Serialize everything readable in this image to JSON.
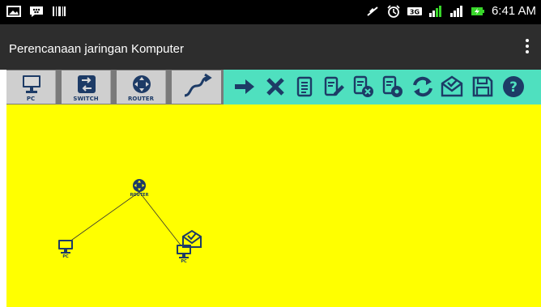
{
  "status_bar": {
    "left_icons": [
      "image-notification-icon",
      "bbm-notification-icon",
      "barcode-notification-icon"
    ],
    "right_icons": [
      "mute-icon",
      "alarm-icon",
      "3g-icon",
      "signal-icon",
      "signal-icon-2",
      "battery-charging-icon"
    ],
    "time": "6:41 AM"
  },
  "action_bar": {
    "title": "Perencanaan jaringan Komputer",
    "overflow_icon": "overflow-menu-icon"
  },
  "toolbar": {
    "devices": [
      {
        "label": "PC",
        "icon": "pc-icon"
      },
      {
        "label": "SWITCH",
        "icon": "switch-icon"
      },
      {
        "label": "ROUTER",
        "icon": "router-icon"
      },
      {
        "label": "",
        "icon": "cable-icon"
      }
    ],
    "tools": [
      "arrow-right-icon",
      "close-icon",
      "document-icon",
      "document-edit-icon",
      "document-remove-icon",
      "document-settings-icon",
      "refresh-icon",
      "mail-icon",
      "save-icon",
      "help-icon"
    ]
  },
  "canvas": {
    "background": "#ffff00",
    "nodes": [
      {
        "label": "ROUTER",
        "type": "router"
      },
      {
        "label": "PC",
        "type": "pc"
      },
      {
        "label": "PC",
        "type": "pc"
      }
    ],
    "message_icon": "mail-icon"
  },
  "colors": {
    "status_bar": "#000000",
    "action_bar": "#2d2d2d",
    "toolbar_gray": "#7a7a7a",
    "device_button": "#cfcfcf",
    "tool_strip": "#4fe0bf",
    "icon_navy": "#1d3b66",
    "canvas": "#ffff00"
  }
}
